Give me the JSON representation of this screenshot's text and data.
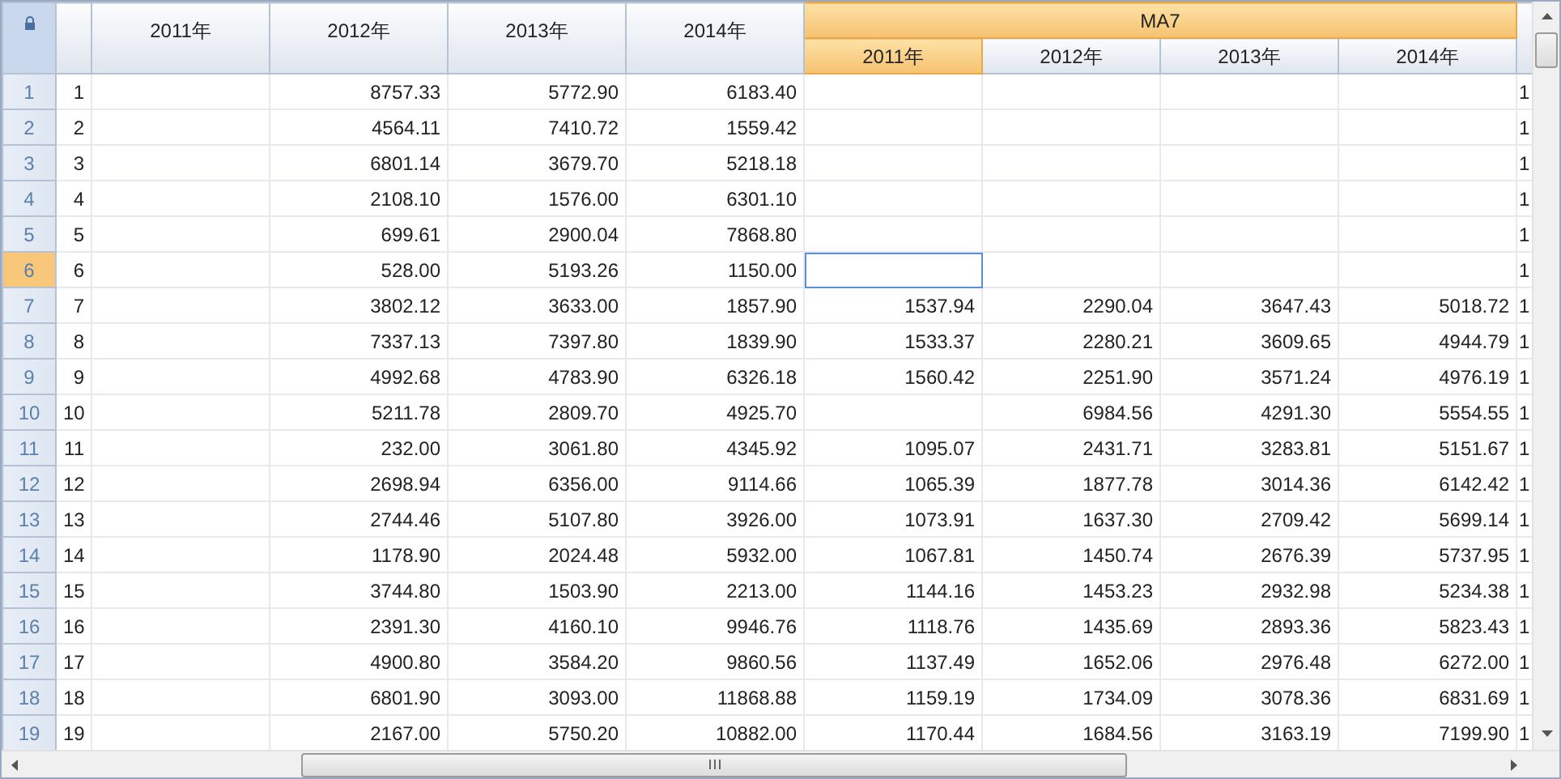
{
  "columns": [
    {
      "label": "2011年"
    },
    {
      "label": "2012年"
    },
    {
      "label": "2013年"
    },
    {
      "label": "2014年"
    }
  ],
  "group": {
    "title": "MA7",
    "columns": [
      {
        "label": "2011年",
        "selected": true
      },
      {
        "label": "2012年",
        "selected": false
      },
      {
        "label": "2013年",
        "selected": false
      },
      {
        "label": "2014年",
        "selected": false
      }
    ]
  },
  "rows": [
    {
      "header": "1",
      "id": "1",
      "selected": false,
      "values": [
        "8757.33",
        "5772.90",
        "6183.40"
      ],
      "cut": "1"
    },
    {
      "header": "2",
      "id": "2",
      "selected": false,
      "values": [
        "4564.11",
        "7410.72",
        "1559.42"
      ],
      "cut": "1"
    },
    {
      "header": "3",
      "id": "3",
      "selected": false,
      "values": [
        "6801.14",
        "3679.70",
        "5218.18"
      ],
      "cut": "1"
    },
    {
      "header": "4",
      "id": "4",
      "selected": false,
      "values": [
        "2108.10",
        "1576.00",
        "6301.10"
      ],
      "cut": "1"
    },
    {
      "header": "5",
      "id": "5",
      "selected": false,
      "values": [
        "699.61",
        "2900.04",
        "7868.80"
      ],
      "cut": "1"
    },
    {
      "header": "6",
      "id": "6",
      "selected": true,
      "values": [
        "528.00",
        "5193.26",
        "1150.00"
      ],
      "cut": "1"
    },
    {
      "header": "7",
      "id": "7",
      "selected": false,
      "values": [
        "3802.12",
        "3633.00",
        "1857.90"
      ],
      "ma7": [
        "1537.94",
        "2290.04",
        "3647.43",
        "5018.72"
      ],
      "cut": "1"
    },
    {
      "header": "8",
      "id": "8",
      "selected": false,
      "values": [
        "7337.13",
        "7397.80",
        "1839.90"
      ],
      "ma7": [
        "1533.37",
        "2280.21",
        "3609.65",
        "4944.79"
      ],
      "cut": "1"
    },
    {
      "header": "9",
      "id": "9",
      "selected": false,
      "values": [
        "4992.68",
        "4783.90",
        "6326.18"
      ],
      "ma7": [
        "1560.42",
        "2251.90",
        "3571.24",
        "4976.19"
      ],
      "cut": "1"
    },
    {
      "header": "10",
      "id": "10",
      "selected": false,
      "values": [
        "5211.78",
        "2809.70",
        "4925.70"
      ],
      "ma7": [
        "6984.56",
        "4291.30",
        "5554.55"
      ],
      "cut": "1"
    },
    {
      "header": "11",
      "id": "11",
      "selected": false,
      "values": [
        "232.00",
        "3061.80",
        "4345.92"
      ],
      "ma7": [
        "1095.07",
        "2431.71",
        "3283.81",
        "5151.67"
      ],
      "cut": "1"
    },
    {
      "header": "12",
      "id": "12",
      "selected": false,
      "values": [
        "2698.94",
        "6356.00",
        "9114.66"
      ],
      "ma7": [
        "1065.39",
        "1877.78",
        "3014.36",
        "6142.42"
      ],
      "cut": "1"
    },
    {
      "header": "13",
      "id": "13",
      "selected": false,
      "values": [
        "2744.46",
        "5107.80",
        "3926.00"
      ],
      "ma7": [
        "1073.91",
        "1637.30",
        "2709.42",
        "5699.14"
      ],
      "cut": "1"
    },
    {
      "header": "14",
      "id": "14",
      "selected": false,
      "values": [
        "1178.90",
        "2024.48",
        "5932.00"
      ],
      "ma7": [
        "1067.81",
        "1450.74",
        "2676.39",
        "5737.95"
      ],
      "cut": "1"
    },
    {
      "header": "15",
      "id": "15",
      "selected": false,
      "values": [
        "3744.80",
        "1503.90",
        "2213.00"
      ],
      "ma7": [
        "1144.16",
        "1453.23",
        "2932.98",
        "5234.38"
      ],
      "cut": "1"
    },
    {
      "header": "16",
      "id": "16",
      "selected": false,
      "values": [
        "2391.30",
        "4160.10",
        "9946.76"
      ],
      "ma7": [
        "1118.76",
        "1435.69",
        "2893.36",
        "5823.43"
      ],
      "cut": "1"
    },
    {
      "header": "17",
      "id": "17",
      "selected": false,
      "values": [
        "4900.80",
        "3584.20",
        "9860.56"
      ],
      "ma7": [
        "1137.49",
        "1652.06",
        "2976.48",
        "6272.00"
      ],
      "cut": "1"
    },
    {
      "header": "18",
      "id": "18",
      "selected": false,
      "values": [
        "6801.90",
        "3093.00",
        "11868.88"
      ],
      "ma7": [
        "1159.19",
        "1734.09",
        "3078.36",
        "6831.69"
      ],
      "cut": "1"
    },
    {
      "header": "19",
      "id": "19",
      "selected": false,
      "values": [
        "2167.00",
        "5750.20",
        "10882.00"
      ],
      "ma7": [
        "1170.44",
        "1684.56",
        "3163.19",
        "7199.90"
      ],
      "cut": "1"
    }
  ]
}
